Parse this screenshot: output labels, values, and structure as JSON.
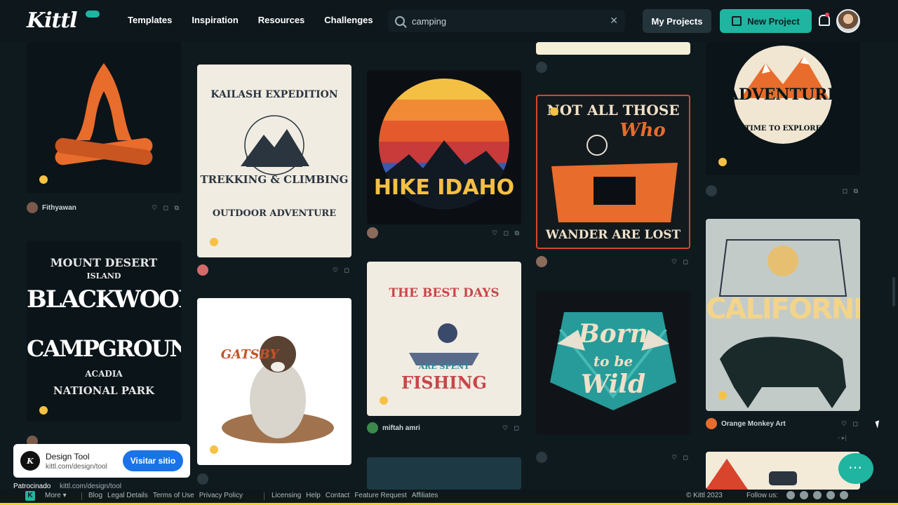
{
  "header": {
    "logo": "Kittl",
    "nav": [
      "Templates",
      "Inspiration",
      "Resources",
      "Challenges"
    ],
    "search": {
      "value": "camping",
      "clear_icon": "close-icon"
    },
    "my_projects": "My Projects",
    "new_project": "New Project"
  },
  "cards": {
    "c1": {
      "author": "Fithyawan",
      "art": "CAMPFIRE"
    },
    "c2": {
      "author": "",
      "art_top": "KAILASH EXPEDITION",
      "art_mid": "TREKKING & CLIMBING",
      "art_bottom": "OUTDOOR ADVENTURE"
    },
    "c3": {
      "author": "",
      "art": "HIKE IDAHO"
    },
    "c4": {
      "author": ""
    },
    "c5": {
      "author": "",
      "art_top": "NOT ALL THOSE",
      "art_who": "Who",
      "art_bottom": "WANDER ARE LOST"
    },
    "c6": {
      "author": "",
      "art": "ADVENTURE",
      "art_sub": "TIME TO EXPLORE"
    },
    "c7": {
      "author": "",
      "art_top": "MOUNT DESERT",
      "art_island": "ISLAND",
      "art_a": "BLACKWOODS",
      "art_b": "CAMPGROUND",
      "art_c": "ACADIA",
      "art_bottom": "NATIONAL PARK"
    },
    "c8": {
      "author": "",
      "art": "GATSBY"
    },
    "c9": {
      "author": "miftah amri",
      "art_top": "THE BEST DAYS",
      "art_mid": "ARE SPENT",
      "art_bottom": "FISHING"
    },
    "c10": {
      "author": "",
      "art_a": "Born",
      "art_b": "to be",
      "art_c": "Wild"
    },
    "c11": {
      "author": "Orange Monkey Art",
      "art": "CALIFORNIA"
    }
  },
  "ad": {
    "title": "Design Tool",
    "url": "kittl.com/design/tool",
    "cta": "Visitar sitio",
    "sponsored": "Patrocinado",
    "sponsored_url": "kittl.com/design/tool"
  },
  "footer": {
    "more": "More",
    "links": [
      "Blog",
      "Legal Details",
      "Terms of Use",
      "Privacy Policy"
    ],
    "links2": [
      "Licensing",
      "Help",
      "Contact",
      "Feature Request",
      "Affiliates"
    ],
    "copyright": "© Kittl 2023",
    "follow": "Follow us:"
  },
  "colors": {
    "accent": "#1fb5a0",
    "background": "#0f1a1f",
    "header": "#0d171c",
    "orange": "#e86c2c",
    "yellow_bar": "#f3d31f"
  }
}
